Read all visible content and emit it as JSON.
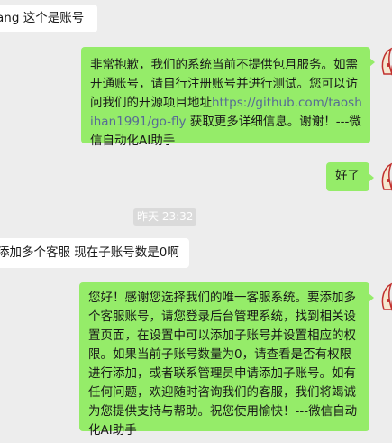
{
  "messages": {
    "m1": {
      "text": "ang 这个是账号"
    },
    "m2": {
      "before": "非常抱歉，我们的系统当前不提供包月服务。如需开通账号，请自行注册账号并进行测试。您可以访问我们的开源项目地址",
      "link": "https://github.com/taoshihan1991/go-fly",
      "after": " 获取更多详细信息。谢谢！---微信自动化AI助手"
    },
    "m3": {
      "text": "好了"
    },
    "m4": {
      "text": "添加多个客服 现在子账号数是0啊"
    },
    "m5": {
      "text": "您好！感谢您选择我们的唯一客服系统。要添加多个客服账号，请您登录后台管理系统，找到相关设置页面，在设置中可以添加子账号并设置相应的权限。如果当前子账号数量为0，请查看是否有权限进行添加，或者联系管理员申请添加子账号。如有任何问题，欢迎随时咨询我们的客服，我们将竭诚为您提供支持与帮助。祝您使用愉快！---微信自动化AI助手"
    }
  },
  "timestamp": "昨天 23:32",
  "colors": {
    "chat_bg": "#ededed",
    "incoming_bubble": "#ffffff",
    "outgoing_bubble": "#95ec69",
    "link": "#576b95"
  },
  "icons": {
    "self_avatar": "lotus-flower-avatar"
  }
}
